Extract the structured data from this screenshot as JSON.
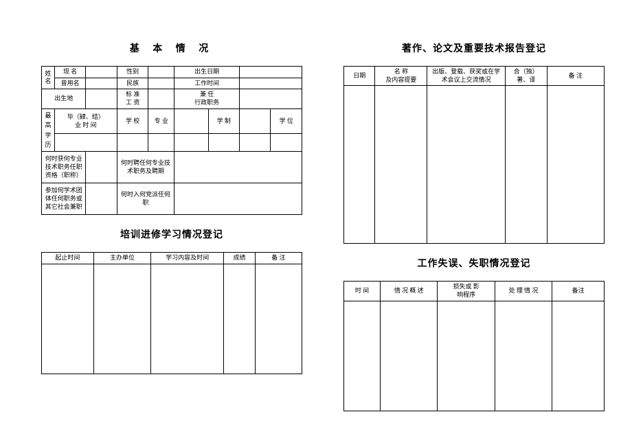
{
  "left": {
    "title1": "基 本 情 况",
    "basic": {
      "name_label": "姓名",
      "current_name": "现 名",
      "former_name": "曾用名",
      "gender": "性别",
      "ethnicity": "民族",
      "birth_date": "出生日期",
      "work_date": "工作时间",
      "birth_place": "出生地",
      "std_wage": "标 准\n工 资",
      "concurrent": "兼 任\n行政职务",
      "highest_edu": "最高学历",
      "grad_end": "毕（肄、结）\n业 时 间",
      "school": "学 校",
      "major": "专 业",
      "schooling": "学 制",
      "degree": "学 位",
      "qual_when": "何时获何专业技术职务任职资格（职称）",
      "hire_when": "何时聘任何专业技术职务及聘期",
      "assoc_when": "参加何学术团体任何职务或其它社会兼职",
      "party_when": "何时入何党派任何职"
    },
    "title2": "培训进修学习情况登记",
    "training": {
      "c1": "起止时间",
      "c2": "主办单位",
      "c3": "学习内容及时间",
      "c4": "成绩",
      "c5": "备 注"
    }
  },
  "right": {
    "title1": "著作、论文及重要技术报告登记",
    "works": {
      "c1": "日期",
      "c2": "名  称\n及内容提要",
      "c3": "出版、登载、获奖或在学术会议上交流情况",
      "c4": "合（独）\n著、译",
      "c5": "备 注"
    },
    "title2": "工作失误、失职情况登记",
    "fault": {
      "c1": "时 间",
      "c2": "情 况 概 述",
      "c3": "损失或  影\n响程序",
      "c4": "处 理 情 况",
      "c5": "备注"
    }
  }
}
